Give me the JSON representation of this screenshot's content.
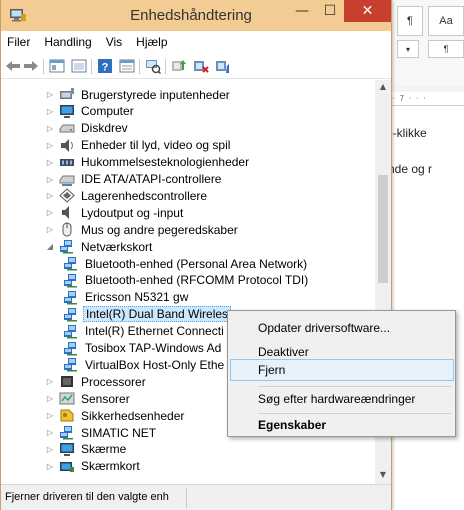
{
  "window": {
    "title": "Enhedshåndtering"
  },
  "menu": [
    "Filer",
    "Handling",
    "Vis",
    "Hjælp"
  ],
  "tree": [
    {
      "label": "Brugerstyrede inputenheder",
      "icon": "input-device-icon",
      "expander": "▷",
      "indent": 0
    },
    {
      "label": "Computer",
      "icon": "computer-icon",
      "expander": "▷",
      "indent": 0
    },
    {
      "label": "Diskdrev",
      "icon": "disk-drive-icon",
      "expander": "▷",
      "indent": 0
    },
    {
      "label": "Enheder til lyd, video og spil",
      "icon": "sound-icon",
      "expander": "▷",
      "indent": 0
    },
    {
      "label": "Hukommelsesteknologienheder",
      "icon": "memory-icon",
      "expander": "▷",
      "indent": 0
    },
    {
      "label": "IDE ATA/ATAPI-controllere",
      "icon": "ide-controller-icon",
      "expander": "▷",
      "indent": 0
    },
    {
      "label": "Lagerenhedscontrollere",
      "icon": "storage-controller-icon",
      "expander": "▷",
      "indent": 0
    },
    {
      "label": "Lydoutput og -input",
      "icon": "speaker-icon",
      "expander": "▷",
      "indent": 0
    },
    {
      "label": "Mus og andre pegeredskaber",
      "icon": "mouse-icon",
      "expander": "▷",
      "indent": 0
    },
    {
      "label": "Netværkskort",
      "icon": "network-adapter-icon",
      "expander": "◢",
      "indent": 0
    },
    {
      "label": "Bluetooth-enhed (Personal Area Network)",
      "icon": "network-adapter-icon",
      "expander": "",
      "indent": 1
    },
    {
      "label": "Bluetooth-enhed (RFCOMM Protocol TDI)",
      "icon": "network-adapter-icon",
      "expander": "",
      "indent": 1
    },
    {
      "label": "Ericsson N5321 gw",
      "icon": "network-adapter-icon",
      "expander": "",
      "indent": 1
    },
    {
      "label": "Intel(R) Dual Band Wireles",
      "icon": "network-adapter-icon",
      "expander": "",
      "indent": 1,
      "selected": true
    },
    {
      "label": "Intel(R) Ethernet Connecti",
      "icon": "network-adapter-icon",
      "expander": "",
      "indent": 1
    },
    {
      "label": "Tosibox TAP-Windows Ad",
      "icon": "network-adapter-icon",
      "expander": "",
      "indent": 1
    },
    {
      "label": "VirtualBox Host-Only Ethe",
      "icon": "network-adapter-icon",
      "expander": "",
      "indent": 1
    },
    {
      "label": "Processorer",
      "icon": "processor-icon",
      "expander": "▷",
      "indent": 0
    },
    {
      "label": "Sensorer",
      "icon": "sensor-icon",
      "expander": "▷",
      "indent": 0
    },
    {
      "label": "Sikkerhedsenheder",
      "icon": "security-device-icon",
      "expander": "▷",
      "indent": 0
    },
    {
      "label": "SIMATIC NET",
      "icon": "network-adapter-icon",
      "expander": "▷",
      "indent": 0
    },
    {
      "label": "Skærme",
      "icon": "monitor-icon",
      "expander": "▷",
      "indent": 0
    },
    {
      "label": "Skærmkort",
      "icon": "display-adapter-icon",
      "expander": "▷",
      "indent": 0
    }
  ],
  "context_menu": {
    "update": "Opdater driversoftware...",
    "disable": "Deaktiver",
    "uninstall": "Fjern",
    "scan": "Søg efter hardwareændringer",
    "properties": "Egenskaber"
  },
  "status": {
    "text": "Fjerner driveren til den valgte enh"
  },
  "background": {
    "btn1": "Aa",
    "btn2": "¶",
    "ruler": "· · · 7 · · ·",
    "line1": "øjre-klikke",
    "line2": "å finde og r"
  }
}
